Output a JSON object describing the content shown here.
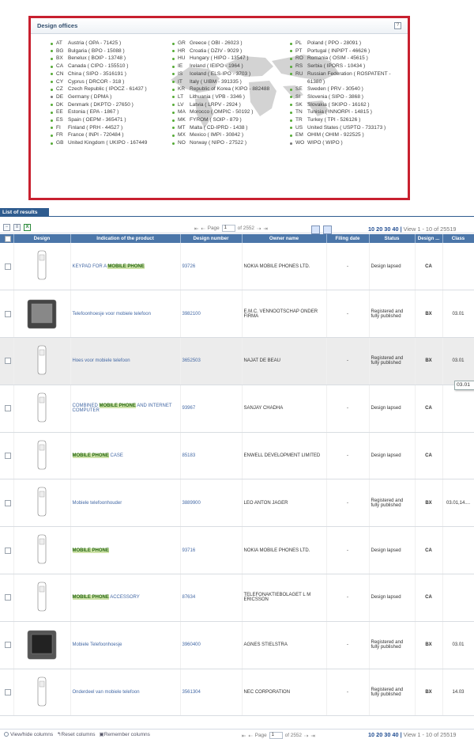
{
  "design_offices": {
    "title": "Design offices",
    "help": "?"
  },
  "offices_col1": [
    {
      "code": "AT",
      "name": "Austria ( OPA - 71425 )",
      "g": false
    },
    {
      "code": "BG",
      "name": "Bulgaria ( BPO - 15088 )",
      "g": false
    },
    {
      "code": "BX",
      "name": "Benelux ( BOIP - 13748 )",
      "g": false
    },
    {
      "code": "CA",
      "name": "Canada ( CIPO - 155510 )",
      "g": false
    },
    {
      "code": "CN",
      "name": "China ( SIPO - 3516191 )",
      "g": false
    },
    {
      "code": "CY",
      "name": "Cyprus ( DRCOR - 318 )",
      "g": false
    },
    {
      "code": "CZ",
      "name": "Czech Republic ( IPOCZ - 61437 )",
      "g": false
    },
    {
      "code": "DE",
      "name": "Germany ( DPMA )",
      "g": true
    },
    {
      "code": "DK",
      "name": "Denmark ( DKPTO - 27650 )",
      "g": false
    },
    {
      "code": "EE",
      "name": "Estonia ( EPA - 1867 )",
      "g": false
    },
    {
      "code": "ES",
      "name": "Spain ( OEPM - 365471 )",
      "g": false
    },
    {
      "code": "FI",
      "name": "Finland ( PRH - 44527 )",
      "g": false
    },
    {
      "code": "FR",
      "name": "France ( INPI - 720484 )",
      "g": false
    },
    {
      "code": "GB",
      "name": "United Kingdom ( UKIPO - 167449",
      "g": false
    }
  ],
  "offices_col2": [
    {
      "code": "GR",
      "name": "Greece ( OBI - 26023 )",
      "g": false
    },
    {
      "code": "HR",
      "name": "Croatia ( DZIV - 9029 )",
      "g": false
    },
    {
      "code": "HU",
      "name": "Hungary ( HIPO - 13547 )",
      "g": false
    },
    {
      "code": "IE",
      "name": "Ireland ( IEIPO - 1964 )",
      "g": false
    },
    {
      "code": "IS",
      "name": "Iceland ( ELS-IPO - 3703 )",
      "g": false
    },
    {
      "code": "IT",
      "name": "Italy ( UIBM - 391335 )",
      "g": false
    },
    {
      "code": "KR",
      "name": "Republic of Korea ( KIPO - 882488",
      "g": false
    },
    {
      "code": "LT",
      "name": "Lithuania ( VPB - 3346 )",
      "g": false
    },
    {
      "code": "LV",
      "name": "Latvia ( LRPV - 2924 )",
      "g": false
    },
    {
      "code": "MA",
      "name": "Morocco ( OMPIC - 50192 )",
      "g": false
    },
    {
      "code": "MK",
      "name": "FYROM ( SOIP - 879 )",
      "g": false
    },
    {
      "code": "MT",
      "name": "Malta ( CD-IPRD - 1438 )",
      "g": false
    },
    {
      "code": "MX",
      "name": "Mexico ( IMPI - 30842 )",
      "g": false
    },
    {
      "code": "NO",
      "name": "Norway ( NIPO - 27522 )",
      "g": false
    }
  ],
  "offices_col3": [
    {
      "code": "PL",
      "name": "Poland ( PPO - 28091 )",
      "g": false
    },
    {
      "code": "PT",
      "name": "Portugal ( INPIPT - 46626 )",
      "g": false
    },
    {
      "code": "RO",
      "name": "Romania ( OSIM - 45615 )",
      "g": false
    },
    {
      "code": "RS",
      "name": "Serbia ( IPORS - 10434 )",
      "g": false
    },
    {
      "code": "RU",
      "name": "Russian Federation ( ROSPATENT -",
      "g": false
    },
    {
      "code": "",
      "name": "61380 )",
      "g": false
    },
    {
      "code": "SE",
      "name": "Sweden ( PRV - 30540 )",
      "g": false
    },
    {
      "code": "SI",
      "name": "Slovenia ( SIPO - 3868 )",
      "g": false
    },
    {
      "code": "SK",
      "name": "Slovakia ( SKIPO - 16162 )",
      "g": false
    },
    {
      "code": "TN",
      "name": "Tunisia ( INNORPI - 14815 )",
      "g": false
    },
    {
      "code": "TR",
      "name": "Turkey ( TPI - 526126 )",
      "g": false
    },
    {
      "code": "US",
      "name": "United States ( USPTO - 733173 )",
      "g": false
    },
    {
      "code": "EM",
      "name": "OHIM ( OHIM - 922525 )",
      "g": false
    },
    {
      "code": "WO",
      "name": "WIPO ( WIPO )",
      "g": true
    }
  ],
  "results": {
    "label": "List of results",
    "page_label": "Page",
    "page_value": "1",
    "page_total": "of 2552",
    "sizes": "10 20 30 40",
    "view": "View 1 - 10 of 25519",
    "tooltip": "03.01"
  },
  "columns": [
    "Design",
    "Indication of the product",
    "Design number",
    "Owner name",
    "Filing date",
    "Status",
    "Design ...",
    "Class"
  ],
  "rows": [
    {
      "pre": "KEYPAD FOR A",
      "hit": "MOBILE PHONE",
      "post": "",
      "number": "93726",
      "owner": "NOKIA MOBILE PHONES LTD.",
      "date": "-",
      "status": "Design lapsed",
      "office": "CA",
      "class": ""
    },
    {
      "pre": "Telefoonhoesje voor mobiele telefoon",
      "hit": "",
      "post": "",
      "number": "3982100",
      "owner": "E.M.C. VENNOOTSCHAP ONDER FIRMA",
      "date": "-",
      "status": "Registered and fully published",
      "office": "BX",
      "class": "03.01"
    },
    {
      "pre": "Hoes voor mobiele telefoon",
      "hit": "",
      "post": "",
      "number": "3652503",
      "owner": "NAJAT DE BEAU",
      "date": "-",
      "status": "Registered and fully published",
      "office": "BX",
      "class": "03.01"
    },
    {
      "pre": "COMBINED",
      "hit": "MOBILE PHONE",
      "post": "AND INTERNET COMPUTER",
      "number": "93967",
      "owner": "SANJAY CHADHA",
      "date": "-",
      "status": "Design lapsed",
      "office": "CA",
      "class": ""
    },
    {
      "pre": "",
      "hit": "MOBILE PHONE",
      "post": "CASE",
      "number": "85183",
      "owner": "ENWELL DEVELOPMENT LIMITED",
      "date": "-",
      "status": "Design lapsed",
      "office": "CA",
      "class": ""
    },
    {
      "pre": "Mobiele telefoonhouder",
      "hit": "",
      "post": "",
      "number": "3889900",
      "owner": "LEO ANTON JAGER",
      "date": "-",
      "status": "Registered and fully published",
      "office": "BX",
      "class": "03.01,14...."
    },
    {
      "pre": "",
      "hit": "MOBILE PHONE",
      "post": "",
      "number": "93716",
      "owner": "NOKIA MOBILE PHONES LTD.",
      "date": "-",
      "status": "Design lapsed",
      "office": "CA",
      "class": ""
    },
    {
      "pre": "",
      "hit": "MOBILE PHONE",
      "post": "ACCESSORY",
      "number": "87634",
      "owner": "TELEFONAKTIEBOLAGET L M ERICSSON",
      "date": "-",
      "status": "Design lapsed",
      "office": "CA",
      "class": ""
    },
    {
      "pre": "Mobiele Telefoonhoesje",
      "hit": "",
      "post": "",
      "number": "3960400",
      "owner": "AGNES STIELSTRA",
      "date": "-",
      "status": "Registered and fully published",
      "office": "BX",
      "class": "03.01"
    },
    {
      "pre": "Onderdeel van mobiele telefoon",
      "hit": "",
      "post": "",
      "number": "3561304",
      "owner": "NEC CORPORATION",
      "date": "-",
      "status": "Registered and fully published",
      "office": "BX",
      "class": "14.03"
    }
  ],
  "footer": {
    "view_hide": "View/hide columns",
    "reset": "Reset columns",
    "remember": "Remember columns",
    "page_label": "Page",
    "page_value": "1",
    "page_total": "of 2552",
    "sizes": "10 20 30 40",
    "view": "View 1 - 10 of 25519"
  }
}
